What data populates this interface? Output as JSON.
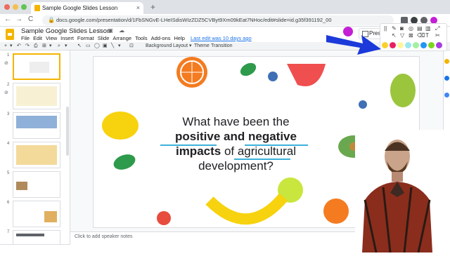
{
  "browser": {
    "tab_title": "Sample Google Slides Lesson",
    "tab_close": "×",
    "new_tab": "+",
    "url": "docs.google.com/presentation/d/1FbSNGvE-LHeISdisWIzZDZ5CVByt9Xm09kEat7NHoc/edit#slide=id.g35f391192_00",
    "nav_back": "←",
    "nav_forward": "→",
    "nav_reload": "C"
  },
  "app": {
    "doc_title": "Sample Google Slides Lesson",
    "title_icons": "☆ ▣ ☁",
    "menus": [
      "File",
      "Edit",
      "View",
      "Insert",
      "Format",
      "Slide",
      "Arrange",
      "Tools",
      "Add-ons",
      "Help"
    ],
    "last_edit": "Last edit was 10 days ago",
    "present_label": "Prese"
  },
  "toolbar": {
    "items": [
      "+",
      "▾",
      "↶",
      "↷",
      "⎙",
      "⊞",
      "▾",
      "⌕",
      "▾",
      "↖",
      "▭",
      "◯",
      "▣",
      "╲",
      "▾",
      "⊡",
      "Background",
      "Layout ▾",
      "Theme",
      "Transition"
    ]
  },
  "filmstrip": {
    "slides": [
      {
        "num": "1",
        "selected": true
      },
      {
        "num": "2",
        "selected": false
      },
      {
        "num": "3",
        "selected": false
      },
      {
        "num": "4",
        "selected": false
      },
      {
        "num": "5",
        "selected": false
      },
      {
        "num": "6",
        "selected": false
      },
      {
        "num": "7",
        "selected": false
      }
    ]
  },
  "slide": {
    "line1": "What have been the",
    "line2a": "positive",
    "line2b": "and",
    "line2c": "negative",
    "line3a": "impacts",
    "line3b": "of agricultural",
    "line4": "development?"
  },
  "notes": {
    "placeholder": "Click to add speaker notes"
  },
  "annotation_tool": {
    "pen_colors": [
      "#f8d12f",
      "#e91e63",
      "#fff59d",
      "#9be7f0",
      "#a2f0a2",
      "#2196f3",
      "#7cd61f",
      "#a83ee0"
    ],
    "handle": "||"
  },
  "colors": {
    "accent": "#f4b400",
    "arrow": "#1c3ad9",
    "underline": "#3cb0d8"
  }
}
